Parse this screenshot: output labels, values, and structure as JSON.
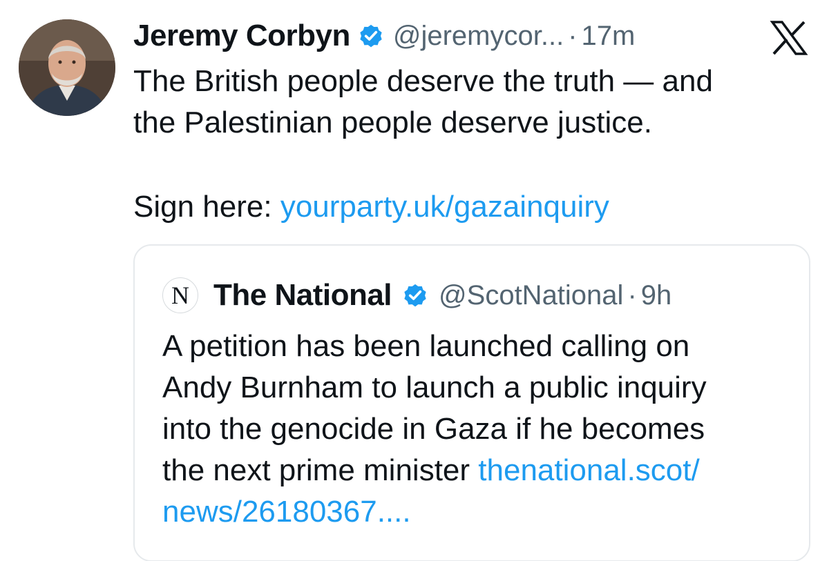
{
  "tweet": {
    "display_name": "Jeremy Corbyn",
    "handle": "@jeremycor...",
    "separator": "·",
    "time": "17m",
    "lines": [
      "The British people deserve the truth — and",
      "the Palestinian people deserve justice."
    ],
    "sign_prefix": "Sign here: ",
    "sign_link": "yourparty.uk/gazainquiry",
    "icons": {
      "verified": "verified-badge-icon",
      "platform": "x-logo-icon",
      "avatar": "avatar"
    }
  },
  "quote": {
    "avatar_letter": "N",
    "display_name": "The National",
    "handle": "@ScotNational",
    "separator": "·",
    "time": "9h",
    "lines": [
      "A petition has been launched calling on",
      "Andy Burnham to launch a public inquiry",
      "into the genocide in Gaza if he becomes"
    ],
    "last_line_text": "the next prime minister ",
    "link_part1": "thenational.scot/",
    "link_part2": "news/26180367...."
  },
  "colors": {
    "text": "#0f1419",
    "muted": "#536471",
    "link": "#1d9bf0",
    "verified": "#1d9bf0",
    "border": "#e6e9ec"
  }
}
